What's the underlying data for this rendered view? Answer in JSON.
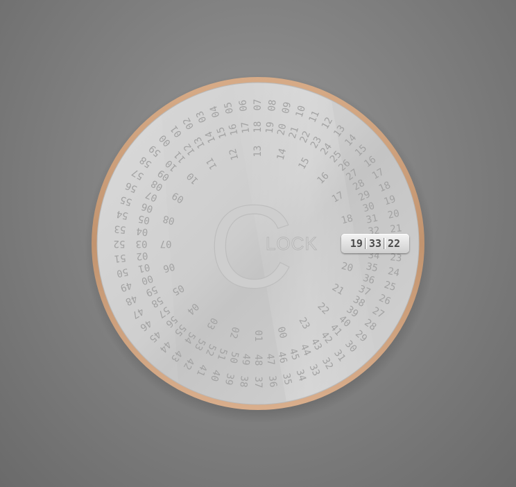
{
  "app": {
    "logo": {
      "big_letter": "C",
      "word": "LOCK"
    }
  },
  "colors": {
    "background": "#858585",
    "bezel": "#c79a77",
    "face": "#cfcfcf",
    "digits": "#a3a3a3",
    "readout_text": "#4a4a4a"
  },
  "time": {
    "hours": "19",
    "minutes": "33",
    "seconds": "22"
  },
  "rings": {
    "seconds": [
      "00",
      "01",
      "02",
      "03",
      "04",
      "05",
      "06",
      "07",
      "08",
      "09",
      "10",
      "11",
      "12",
      "13",
      "14",
      "15",
      "16",
      "17",
      "18",
      "19",
      "20",
      "21",
      "22",
      "23",
      "24",
      "25",
      "26",
      "27",
      "28",
      "29",
      "30",
      "31",
      "32",
      "33",
      "34",
      "35",
      "36",
      "37",
      "38",
      "39",
      "40",
      "41",
      "42",
      "43",
      "44",
      "45",
      "46",
      "47",
      "48",
      "49",
      "50",
      "51",
      "52",
      "53",
      "54",
      "55",
      "56",
      "57",
      "58",
      "59"
    ],
    "minutes": [
      "00",
      "01",
      "02",
      "03",
      "04",
      "05",
      "06",
      "07",
      "08",
      "09",
      "10",
      "11",
      "12",
      "13",
      "14",
      "15",
      "16",
      "17",
      "18",
      "19",
      "20",
      "21",
      "22",
      "23",
      "24",
      "25",
      "26",
      "27",
      "28",
      "29",
      "30",
      "31",
      "32",
      "33",
      "34",
      "35",
      "36",
      "37",
      "38",
      "39",
      "40",
      "41",
      "42",
      "43",
      "44",
      "45",
      "46",
      "47",
      "48",
      "49",
      "50",
      "51",
      "52",
      "53",
      "54",
      "55",
      "56",
      "57",
      "58",
      "59"
    ],
    "hours": [
      "00",
      "01",
      "02",
      "03",
      "04",
      "05",
      "06",
      "07",
      "08",
      "09",
      "10",
      "11",
      "12",
      "13",
      "14",
      "15",
      "16",
      "17",
      "18",
      "19",
      "20",
      "21",
      "22",
      "23"
    ]
  }
}
